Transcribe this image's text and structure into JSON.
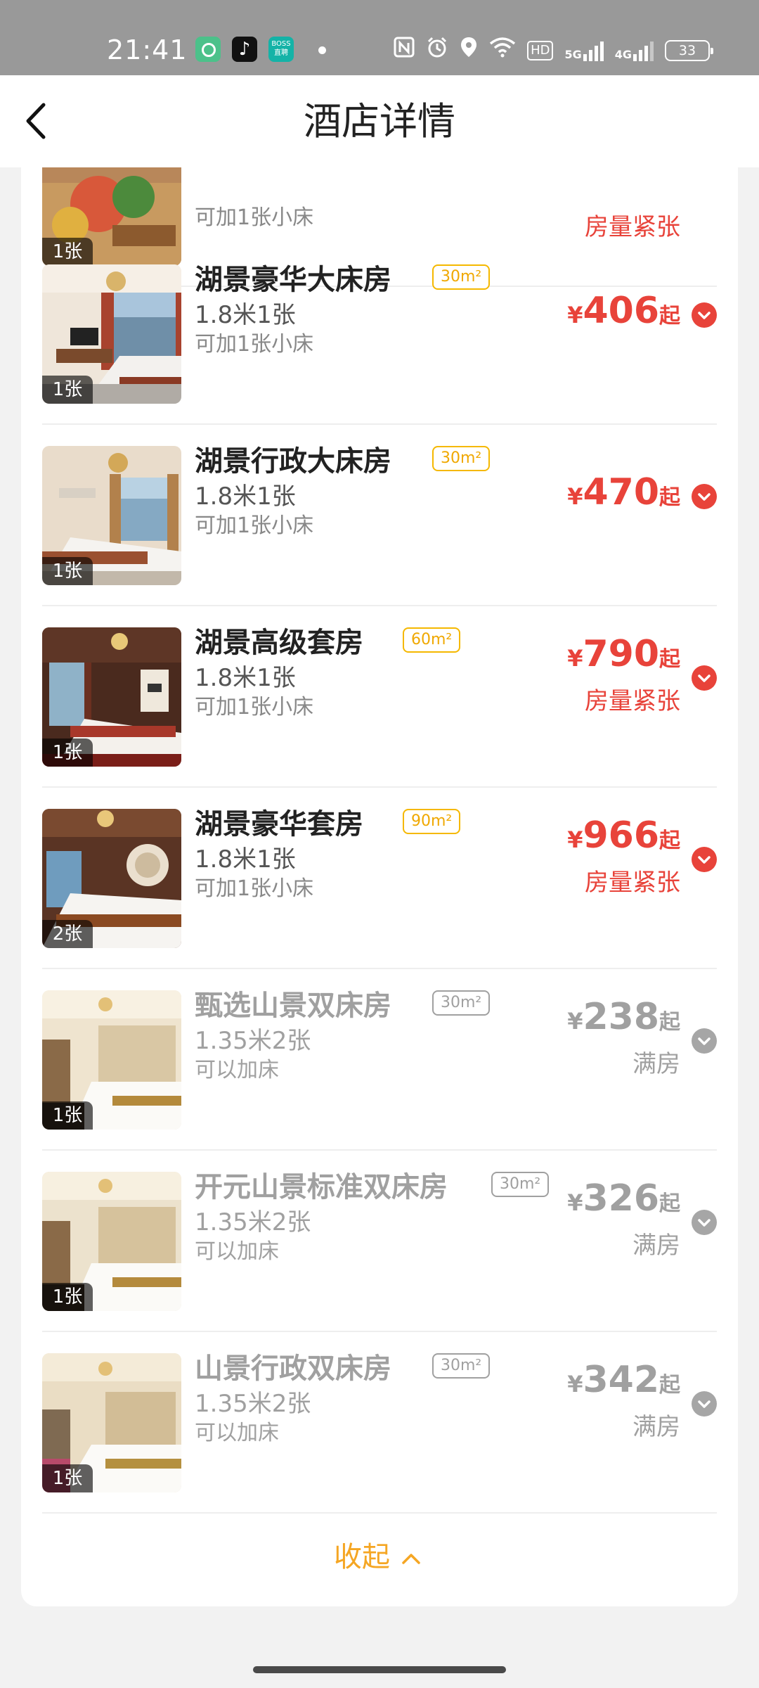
{
  "status_bar": {
    "time": "21:41",
    "apps": [
      "message-app-icon",
      "tiktok-icon",
      "boss-zhipin-icon"
    ],
    "boss_label_line1": "BOSS",
    "boss_label_line2": "直聘",
    "network_5g": "5G",
    "network_4g": "4G",
    "hd_label": "HD",
    "battery": "33"
  },
  "header": {
    "title": "酒店详情",
    "back_icon": "chevron-left-icon"
  },
  "rooms": [
    {
      "name": "",
      "area": "",
      "bed": "",
      "extra": "可加1张小床",
      "bed_count": "1张",
      "currency": "",
      "price": "",
      "suffix": "",
      "note": "房量紧张"
    },
    {
      "name": "湖景豪华大床房",
      "area": "30m²",
      "bed": "1.8米1张",
      "extra": "可加1张小床",
      "bed_count": "1张",
      "currency": "¥",
      "price": "406",
      "suffix": "起",
      "note": ""
    },
    {
      "name": "湖景行政大床房",
      "area": "30m²",
      "bed": "1.8米1张",
      "extra": "可加1张小床",
      "bed_count": "1张",
      "currency": "¥",
      "price": "470",
      "suffix": "起",
      "note": ""
    },
    {
      "name": "湖景高级套房",
      "area": "60m²",
      "bed": "1.8米1张",
      "extra": "可加1张小床",
      "bed_count": "1张",
      "currency": "¥",
      "price": "790",
      "suffix": "起",
      "note": "房量紧张"
    },
    {
      "name": "湖景豪华套房",
      "area": "90m²",
      "bed": "1.8米1张",
      "extra": "可加1张小床",
      "bed_count": "2张",
      "currency": "¥",
      "price": "966",
      "suffix": "起",
      "note": "房量紧张"
    },
    {
      "name": "甄选山景双床房",
      "area": "30m²",
      "bed": "1.35米2张",
      "extra": "可以加床",
      "bed_count": "1张",
      "currency": "¥",
      "price": "238",
      "suffix": "起",
      "note": "满房"
    },
    {
      "name": "开元山景标准双床房",
      "area": "30m²",
      "bed": "1.35米2张",
      "extra": "可以加床",
      "bed_count": "1张",
      "currency": "¥",
      "price": "326",
      "suffix": "起",
      "note": "满房"
    },
    {
      "name": "山景行政双床房",
      "area": "30m²",
      "bed": "1.35米2张",
      "extra": "可以加床",
      "bed_count": "1张",
      "currency": "¥",
      "price": "342",
      "suffix": "起",
      "note": "满房"
    }
  ],
  "collapse": {
    "label": "收起",
    "icon": "chevron-up-icon"
  },
  "colors": {
    "accent_red": "#e8433a",
    "accent_gold": "#f5a623",
    "disabled_gray": "#a0a0a0"
  }
}
